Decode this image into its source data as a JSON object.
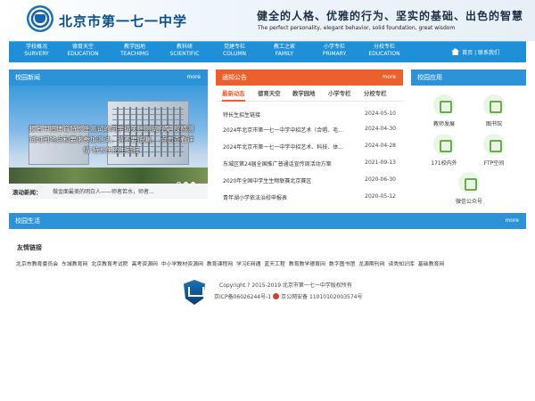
{
  "header": {
    "school_name": "北京市第一七一中学",
    "motto_cn": "健全的人格、优雅的行为、坚实的基础、出色的智慧",
    "motto_en": "The perfect personality, elegant behavior, solid foundation, great wisdom"
  },
  "nav": {
    "items": [
      {
        "cn": "学校概况",
        "en": "SURVERY"
      },
      {
        "cn": "德育天空",
        "en": "EDUCATION"
      },
      {
        "cn": "教学园地",
        "en": "TEACHIMG"
      },
      {
        "cn": "教科研",
        "en": "SCIENTIFIC"
      },
      {
        "cn": "党建专栏",
        "en": "COLUMN"
      },
      {
        "cn": "教工之家",
        "en": "FAMILY"
      },
      {
        "cn": "小学专栏",
        "en": "PRIMARY"
      },
      {
        "cn": "分校专栏",
        "en": "EDUCATION"
      }
    ],
    "right": "首页 | 联系我们"
  },
  "news": {
    "title": "校园新闻",
    "more": "more",
    "caption": "报名中招体育特长生测试的同学请关注测试方案 按照测试时间地点和要求参加测试，请不要遗漏。 点击查看详情 特长生招生链接",
    "scroll_label": "滚动新闻：",
    "scroll_text": "做金面最美的明白人——师者若水，师者..."
  },
  "notice": {
    "title": "通知公告",
    "more": "more",
    "tabs": [
      "最新动态",
      "德育天空",
      "教学园地",
      "小学专栏",
      "分校专栏"
    ],
    "rows": [
      {
        "title": "特长生招生链接",
        "date": "2024-05-10"
      },
      {
        "title": "2024年北京市第一七一中学中招艺术（合唱、毛...",
        "date": "2024-04-30"
      },
      {
        "title": "2024年北京市第一七一中学中招艺术、科技、体...",
        "date": "2024-04-28"
      },
      {
        "title": "东城区第24届全国推广普通话宣传周活动方案",
        "date": "2021-09-13"
      },
      {
        "title": "2020年全国中学生生物联赛北京赛区",
        "date": "2020-06-30"
      },
      {
        "title": "青年湖小学依法治校申报表",
        "date": "2020-05-12"
      }
    ]
  },
  "apps": {
    "title": "校园应用",
    "items": [
      "教师发展",
      "图书馆",
      "171校内外",
      "FTP空间",
      "微信公众号"
    ]
  },
  "life": {
    "title": "校园生活",
    "more": "more"
  },
  "links": {
    "title": "友情链接",
    "list": [
      "北京市教育委员会",
      "东城教育网",
      "北京教育考试院",
      "高考资源网",
      "中小学教材资源网",
      "教育课程网",
      "学习E网通",
      "蓝天工程",
      "教育教学德育网",
      "数字图书馆",
      "龙源期刊网",
      "读秀知识库",
      "基础教育网"
    ]
  },
  "footer": {
    "copyright": "Copyright ? 2015-2019 北京市第一七一中学版权所有",
    "icp": "京ICP备06026244号-1",
    "police": "京公网安备 11010102003574号"
  }
}
